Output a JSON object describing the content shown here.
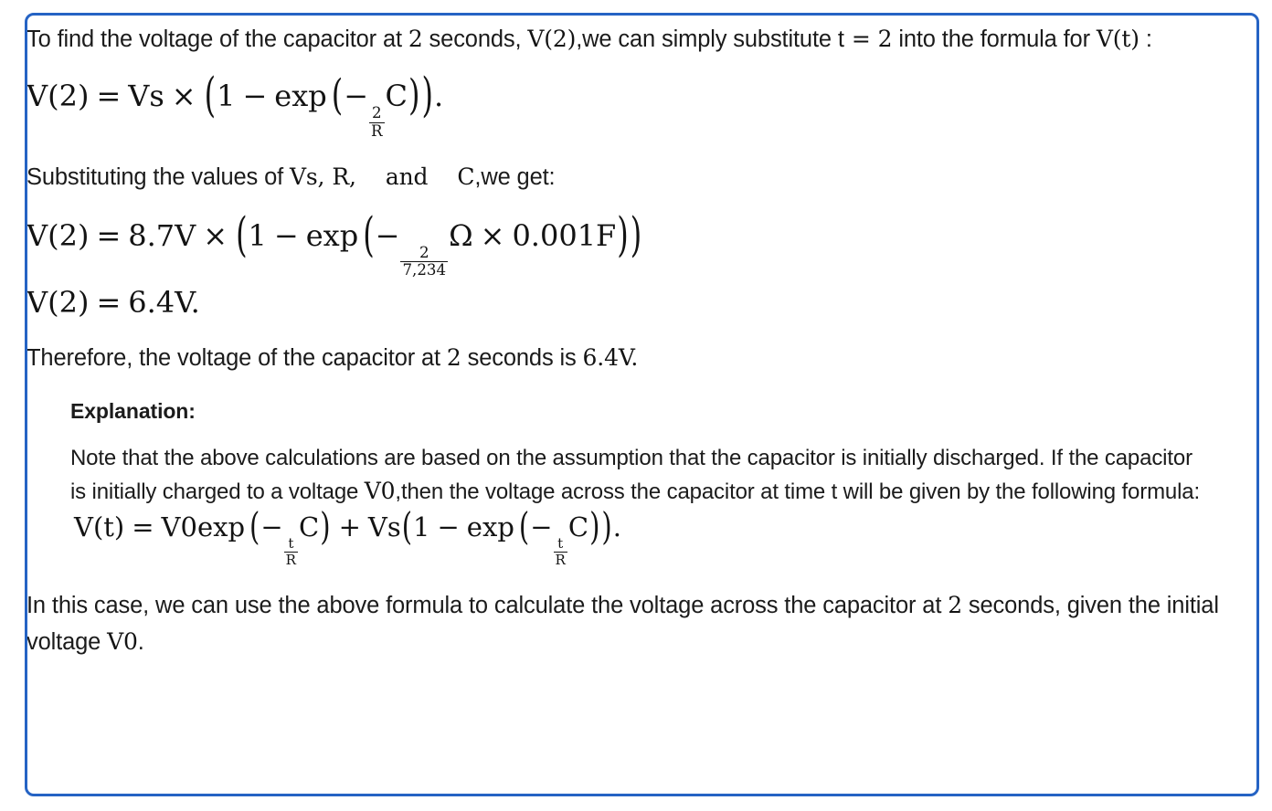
{
  "card": {
    "border_color": "#2563c4",
    "background_color": "#ffffff",
    "text_color": "#1b1b1b"
  },
  "intro_paragraph": {
    "part1": "To find the voltage of the capacitor at ",
    "math_two_a": "2",
    "part2": " seconds, ",
    "math_v2": "V(2)",
    "part3": ",we can simply substitute ",
    "math_t": "t",
    "math_equals": "=",
    "math_two_b": "2",
    "part4": " into the formula for ",
    "math_vt": "V(t)",
    "part5": " :"
  },
  "equation_1": {
    "lhs": "V(2)",
    "equals": "=",
    "vs": "Vs",
    "times": "×",
    "one": "1",
    "minus": "−",
    "exp": "exp",
    "neg": "−",
    "frac_num": "2",
    "frac_den": "R",
    "c": "C",
    "period": "."
  },
  "substituting_paragraph": {
    "part1": "Substituting the values of ",
    "math_vs": "Vs,",
    "math_r": "R,",
    "math_and": "and",
    "math_c": "C",
    "part2": ",we get:"
  },
  "equation_2": {
    "lhs": "V(2)",
    "equals": "=",
    "vs_value": "8.7V",
    "times": "×",
    "one": "1",
    "minus": "−",
    "exp": "exp",
    "neg": "−",
    "frac_num": "2",
    "frac_den": "7,234",
    "ohm": "Ω",
    "times2": "×",
    "cap_value": "0.001F"
  },
  "equation_3": {
    "lhs": "V(2)",
    "equals": "=",
    "result": "6.4V",
    "period": "."
  },
  "therefore_paragraph": {
    "part1": "Therefore, the voltage of the capacitor at ",
    "math_two": "2",
    "part2": " seconds is ",
    "math_result": "6.4V",
    "part3": "."
  },
  "explanation": {
    "heading": "Explanation:",
    "body_part1": "Note that the above calculations are based on the assumption that the capacitor is initially discharged. If the capacitor is initially charged to a voltage ",
    "math_v0": "V0",
    "body_part2": ",then the voltage across the capacitor at time t will be given by the following formula:",
    "formula": {
      "lhs": "V(t)",
      "equals": "=",
      "v0exp": "V0exp",
      "neg": "−",
      "frac_num": "t",
      "frac_den": "R",
      "c": "C",
      "plus": "+",
      "vs": "Vs",
      "one": "1",
      "minus": "−",
      "exp": "exp",
      "neg2": "−",
      "frac2_num": "t",
      "frac2_den": "R",
      "c2": "C",
      "period": "."
    }
  },
  "final_paragraph": {
    "part1": "In this case, we can use the above formula to calculate the voltage across the capacitor at ",
    "math_two": "2",
    "part2": " seconds, given the initial voltage ",
    "math_v0": "V0",
    "part3": "."
  }
}
